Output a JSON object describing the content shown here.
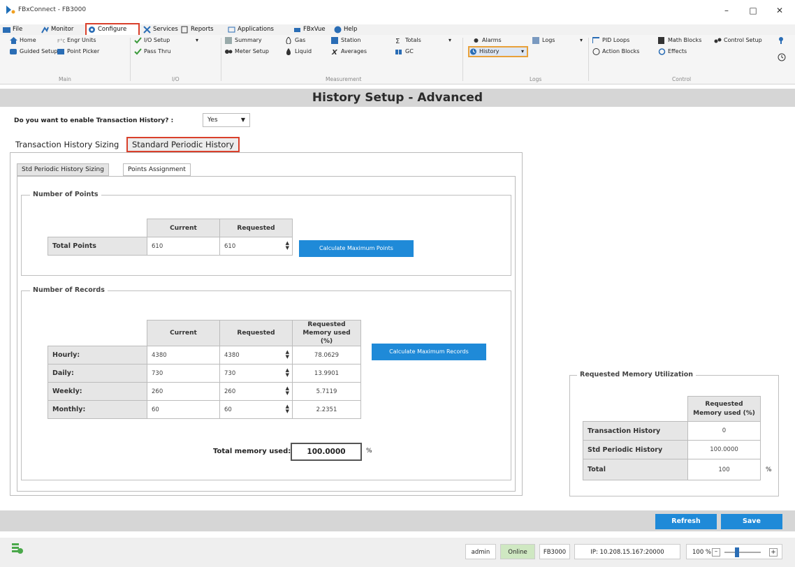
{
  "window": {
    "title": "FBxConnect - FB3000"
  },
  "menu": {
    "file": "File",
    "monitor": "Monitor",
    "configure": "Configure",
    "services": "Services",
    "reports": "Reports",
    "applications": "Applications",
    "fbxvue": "FBxVue",
    "help": "Help"
  },
  "ribbon": {
    "main": {
      "home": "Home",
      "guided_setup": "Guided Setup",
      "engr_units": "Engr Units",
      "point_picker": "Point Picker",
      "label": "Main"
    },
    "io": {
      "io_setup": "I/O Setup",
      "pass_thru": "Pass Thru",
      "label": "I/O"
    },
    "measurement": {
      "summary": "Summary",
      "meter_setup": "Meter Setup",
      "gas": "Gas",
      "liquid": "Liquid",
      "station": "Station",
      "averages": "Averages",
      "totals": "Totals",
      "gc": "GC",
      "label": "Measurement"
    },
    "logs": {
      "alarms": "Alarms",
      "history": "History",
      "logs": "Logs",
      "label": "Logs"
    },
    "control": {
      "pid_loops": "PID Loops",
      "action_blocks": "Action Blocks",
      "math_blocks": "Math Blocks",
      "effects": "Effects",
      "control_setup": "Control Setup",
      "label": "Control"
    }
  },
  "page": {
    "heading": "History Setup - Advanced",
    "enable_question": "Do you want to enable Transaction History? :",
    "enable_value": "Yes",
    "tabs": {
      "transaction": "Transaction History Sizing",
      "standard": "Standard Periodic History"
    },
    "subtabs": {
      "sizing": "Std Periodic History Sizing",
      "assignment": "Points Assignment"
    }
  },
  "points": {
    "group_title": "Number of Points",
    "col_current": "Current",
    "col_requested": "Requested",
    "row_label": "Total Points",
    "current": "610",
    "requested": "610",
    "button": "Calculate Maximum Points"
  },
  "records": {
    "group_title": "Number of Records",
    "col_current": "Current",
    "col_requested": "Requested",
    "col_memory": "Requested Memory used (%)",
    "rows": [
      {
        "label": "Hourly:",
        "current": "4380",
        "requested": "4380",
        "memory": "78.0629"
      },
      {
        "label": "Daily:",
        "current": "730",
        "requested": "730",
        "memory": "13.9901"
      },
      {
        "label": "Weekly:",
        "current": "260",
        "requested": "260",
        "memory": "5.7119"
      },
      {
        "label": "Monthly:",
        "current": "60",
        "requested": "60",
        "memory": "2.2351"
      }
    ],
    "button": "Calculate Maximum Records",
    "total_label": "Total memory used:",
    "total_value": "100.0000",
    "total_unit": "%"
  },
  "memory_util": {
    "title": "Requested Memory Utilization",
    "col_header": "Requested Memory used (%)",
    "rows": [
      {
        "label": "Transaction History",
        "value": "0"
      },
      {
        "label": "Std Periodic History",
        "value": "100.0000"
      },
      {
        "label": "Total",
        "value": "100"
      }
    ],
    "unit": "%"
  },
  "actions": {
    "refresh": "Refresh",
    "save": "Save"
  },
  "status": {
    "user": "admin",
    "state": "Online",
    "device": "FB3000",
    "ip": "IP: 10.208.15.167:20000",
    "zoom": "100 %",
    "zoom_level": 0.35
  },
  "colors": {
    "accent_blue": "#1f8ad8",
    "highlight_red": "#d9402b",
    "highlight_orange": "#e8a13a",
    "online_green": "#cfe8c2"
  }
}
